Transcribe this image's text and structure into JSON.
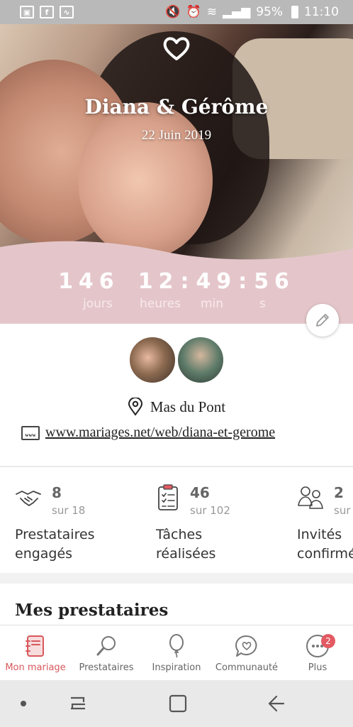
{
  "status_bar": {
    "battery": "95%",
    "time": "11:10"
  },
  "hero": {
    "names": "Diana & Gérôme",
    "date": "22 Juin 2019",
    "countdown": {
      "days": "146",
      "hours": "12",
      "minutes": "49",
      "seconds": "56",
      "days_label": "jours",
      "hours_label": "heures",
      "minutes_label": "min",
      "seconds_label": "s"
    }
  },
  "info": {
    "venue": "Mas du Pont",
    "website": "www.mariages.net/web/diana-et-gerome"
  },
  "stats": [
    {
      "num": "8",
      "sub": "sur 18",
      "label1": "Prestataires",
      "label2": "engagés",
      "icon": "handshake-icon"
    },
    {
      "num": "46",
      "sub": "sur 102",
      "label1": "Tâches",
      "label2": "réalisées",
      "icon": "clipboard-checklist-icon"
    },
    {
      "num": "2",
      "sub": "sur",
      "label1": "Invités",
      "label2": "confirmé",
      "icon": "guests-icon"
    }
  ],
  "section_title": "Mes prestataires",
  "bottom_nav": [
    {
      "label": "Mon mariage",
      "icon": "notebook-icon",
      "active": true
    },
    {
      "label": "Prestataires",
      "icon": "search-icon"
    },
    {
      "label": "Inspiration",
      "icon": "balloon-icon"
    },
    {
      "label": "Communauté",
      "icon": "chat-heart-icon"
    },
    {
      "label": "Plus",
      "icon": "more-icon",
      "badge": "2"
    }
  ],
  "colors": {
    "accent": "#d8585c",
    "pink_band": "#e4c6ca"
  }
}
